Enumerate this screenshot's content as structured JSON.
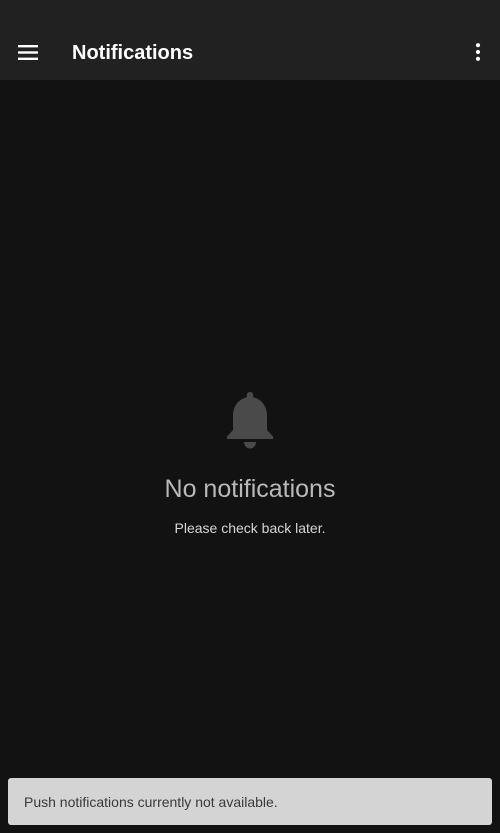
{
  "app_bar": {
    "title": "Notifications",
    "menu_icon": "hamburger-menu-icon",
    "overflow_icon": "more-vert-icon"
  },
  "empty_state": {
    "icon": "bell-icon",
    "title": "No notifications",
    "subtitle": "Please check back later."
  },
  "snackbar": {
    "message": "Push notifications currently not available."
  },
  "colors": {
    "background": "#121212",
    "app_bar": "#212121",
    "snackbar": "#d4d4d4"
  }
}
